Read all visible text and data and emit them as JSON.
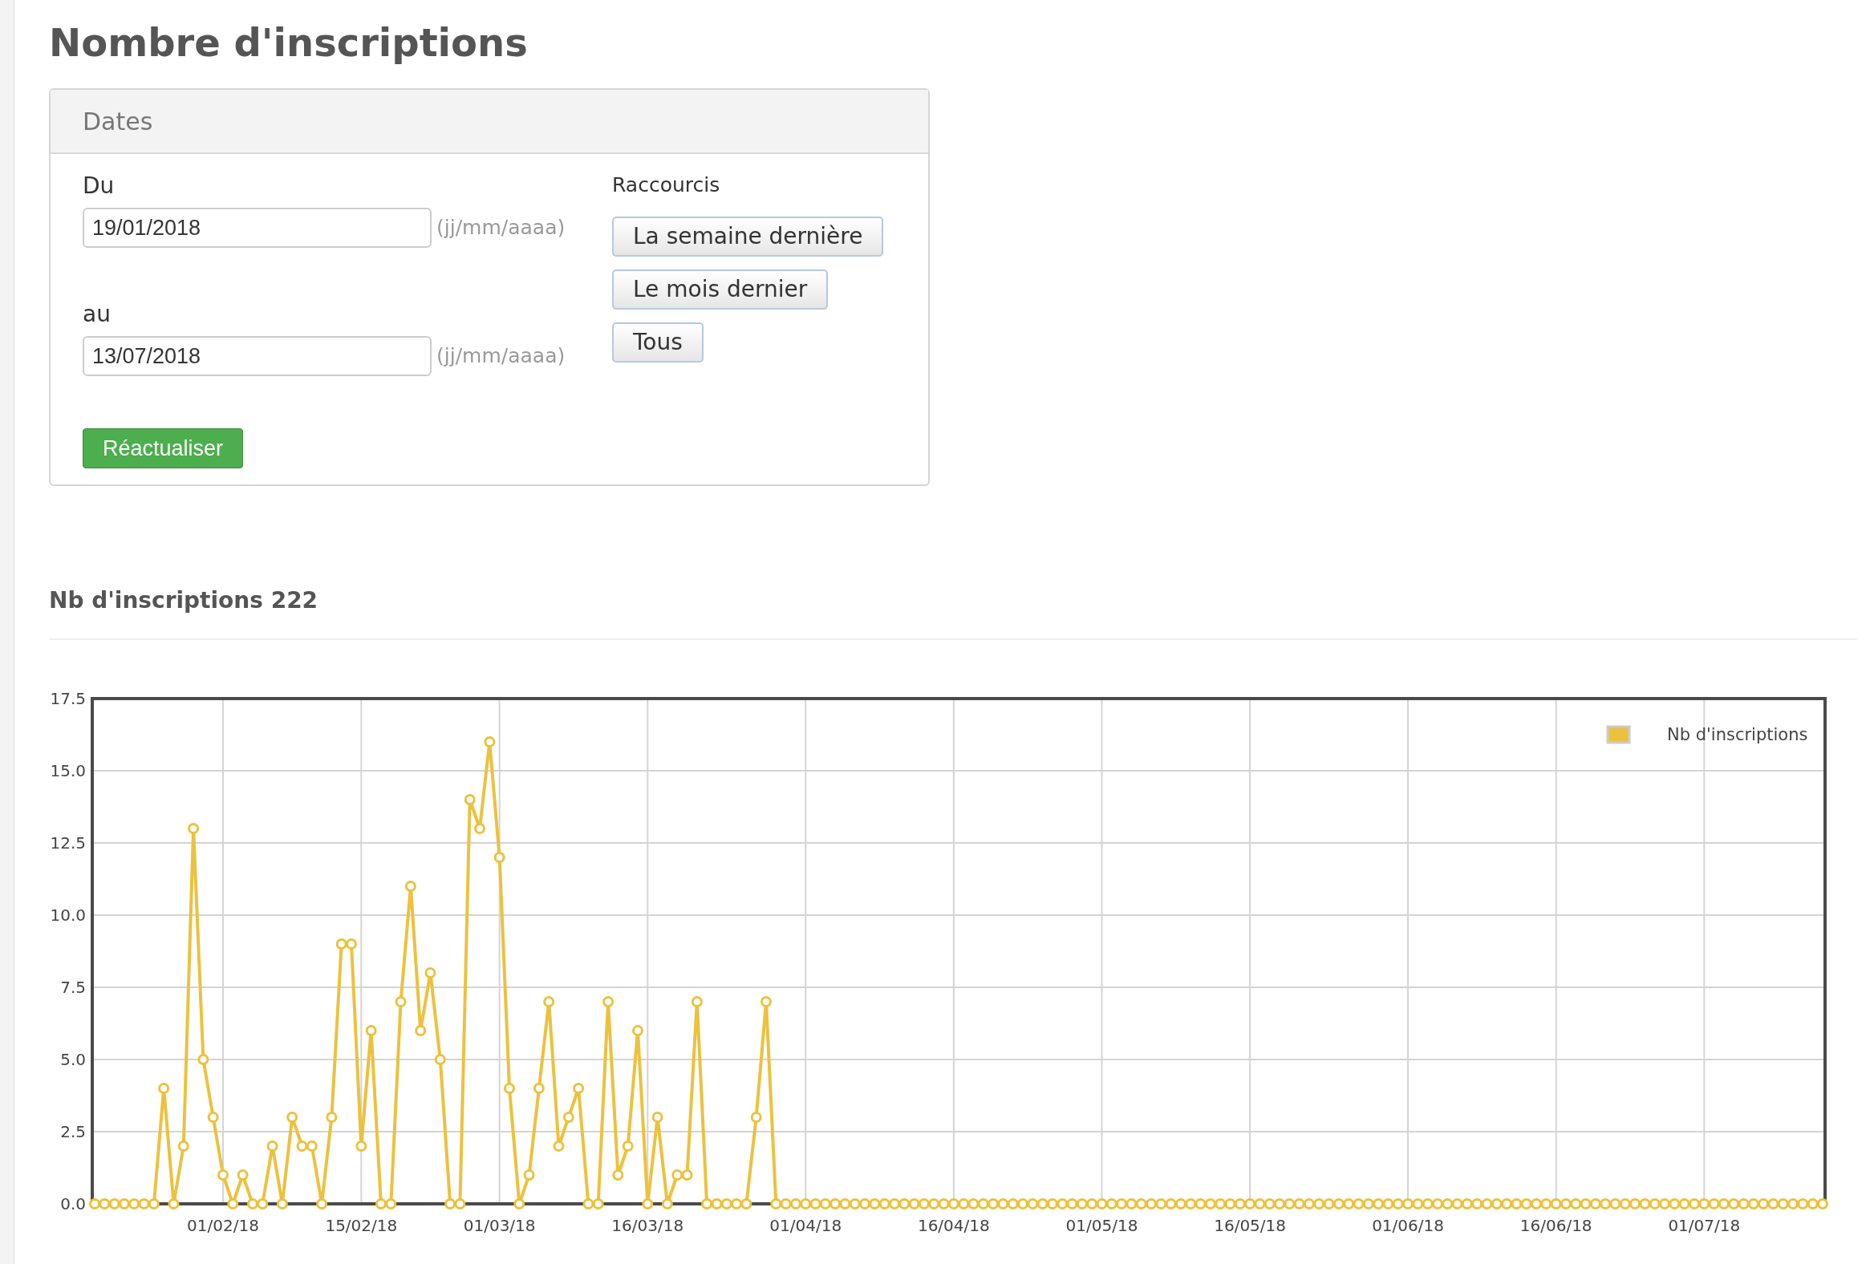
{
  "page_title": "Nombre d'inscriptions",
  "dates_panel": {
    "title": "Dates",
    "from_label": "Du",
    "from_value": "19/01/2018",
    "from_hint": "(jj/mm/aaaa)",
    "to_label": "au",
    "to_value": "13/07/2018",
    "to_hint": "(jj/mm/aaaa)",
    "refresh_button": "Réactualiser",
    "shortcuts_label": "Raccourcis",
    "shortcuts": [
      "La semaine dernière",
      "Le mois dernier",
      "Tous"
    ]
  },
  "chart": {
    "chart_data": {
      "type": "line",
      "title": "Nb d'inscriptions 222",
      "categories": [
        null,
        null,
        null,
        null,
        null,
        null,
        null,
        null,
        null,
        null,
        null,
        null,
        null,
        "01/02/18",
        null,
        null,
        null,
        null,
        null,
        null,
        null,
        null,
        null,
        null,
        null,
        null,
        null,
        "15/02/18",
        null,
        null,
        null,
        null,
        null,
        null,
        null,
        null,
        null,
        null,
        null,
        null,
        null,
        "01/03/18",
        null,
        null,
        null,
        null,
        null,
        null,
        null,
        null,
        null,
        null,
        null,
        null,
        null,
        null,
        "16/03/18",
        null,
        null,
        null,
        null,
        null,
        null,
        null,
        null,
        null,
        null,
        null,
        null,
        null,
        null,
        null,
        "01/04/18",
        null,
        null,
        null,
        null,
        null,
        null,
        null,
        null,
        null,
        null,
        null,
        null,
        null,
        null,
        "16/04/18",
        null,
        null,
        null,
        null,
        null,
        null,
        null,
        null,
        null,
        null,
        null,
        null,
        null,
        null,
        "01/05/18",
        null,
        null,
        null,
        null,
        null,
        null,
        null,
        null,
        null,
        null,
        null,
        null,
        null,
        null,
        "16/05/18",
        null,
        null,
        null,
        null,
        null,
        null,
        null,
        null,
        null,
        null,
        null,
        null,
        null,
        null,
        null,
        "01/06/18",
        null,
        null,
        null,
        null,
        null,
        null,
        null,
        null,
        null,
        null,
        null,
        null,
        null,
        null,
        "16/06/18",
        null,
        null,
        null,
        null,
        null,
        null,
        null,
        null,
        null,
        null,
        null,
        null,
        null,
        null,
        "01/07/18",
        null,
        null,
        null,
        null,
        null,
        null,
        null,
        null,
        null,
        null,
        null,
        null
      ],
      "grid": true,
      "series": [
        {
          "name": "Nb d'inscriptions",
          "color": "#ecc13e",
          "marker": "circle",
          "values": [
            0,
            0,
            0,
            0,
            0,
            0,
            0,
            4,
            0,
            2,
            13,
            5,
            3,
            1,
            0,
            1,
            0,
            0,
            2,
            0,
            3,
            2,
            2,
            0,
            3,
            9,
            9,
            2,
            6,
            0,
            0,
            7,
            11,
            6,
            8,
            5,
            0,
            0,
            14,
            13,
            16,
            12,
            4,
            0,
            1,
            4,
            7,
            2,
            3,
            4,
            0,
            0,
            7,
            1,
            2,
            6,
            0,
            3,
            0,
            1,
            1,
            7,
            0,
            0,
            0,
            0,
            0,
            3,
            7,
            0,
            0,
            0,
            0,
            0,
            0,
            0,
            0,
            0,
            0,
            0,
            0,
            0,
            0,
            0,
            0,
            0,
            0,
            0,
            0,
            0,
            0,
            0,
            0,
            0,
            0,
            0,
            0,
            0,
            0,
            0,
            0,
            0,
            0,
            0,
            0,
            0,
            0,
            0,
            0,
            0,
            0,
            0,
            0,
            0,
            0,
            0,
            0,
            0,
            0,
            0,
            0,
            0,
            0,
            0,
            0,
            0,
            0,
            0,
            0,
            0,
            0,
            0,
            0,
            0,
            0,
            0,
            0,
            0,
            0,
            0,
            0,
            0,
            0,
            0,
            0,
            0,
            0,
            0,
            0,
            0,
            0,
            0,
            0,
            0,
            0,
            0,
            0,
            0,
            0,
            0,
            0,
            0,
            0,
            0,
            0,
            0,
            0,
            0,
            0,
            0,
            0,
            0,
            0,
            0,
            0,
            0
          ]
        }
      ],
      "ylim": [
        0,
        17.5
      ],
      "yticks": [
        {
          "value": 0,
          "label": "0.0"
        },
        {
          "value": 2.5,
          "label": "2.5"
        },
        {
          "value": 5,
          "label": "5.0"
        },
        {
          "value": 7.5,
          "label": "7.5"
        },
        {
          "value": 10,
          "label": "10.0"
        },
        {
          "value": 12.5,
          "label": "12.5"
        },
        {
          "value": 15,
          "label": "15.0"
        },
        {
          "value": 17.5,
          "label": "17.5"
        }
      ]
    }
  }
}
